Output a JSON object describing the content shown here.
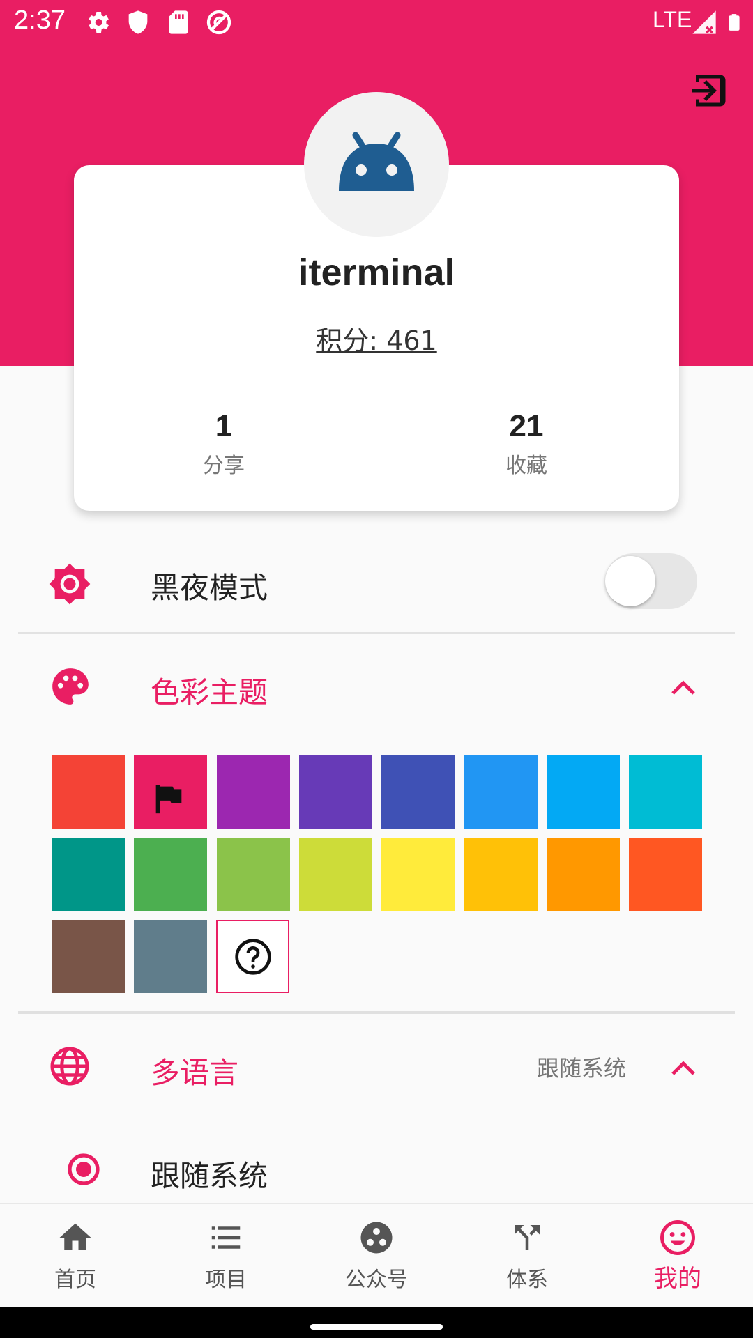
{
  "status_bar": {
    "time": "2:37",
    "network": "LTE"
  },
  "profile": {
    "username": "iterminal",
    "points": "积分: 461",
    "stats": [
      {
        "count": "1",
        "label": "分享"
      },
      {
        "count": "21",
        "label": "收藏"
      }
    ]
  },
  "settings": {
    "dark_mode": {
      "label": "黑夜模式",
      "enabled": false
    },
    "color_theme": {
      "label": "色彩主题",
      "expanded": true,
      "selected": "#e91e63",
      "colors": [
        "#f44336",
        "#e91e63",
        "#9c27b0",
        "#673ab7",
        "#3f51b5",
        "#2196f3",
        "#03a9f4",
        "#00bcd4",
        "#009688",
        "#4caf50",
        "#8bc34a",
        "#cddc39",
        "#ffeb3b",
        "#ffc107",
        "#ff9800",
        "#ff5722",
        "#795548",
        "#607d8b"
      ]
    },
    "language": {
      "label": "多语言",
      "value": "跟随系统",
      "expanded": true,
      "options": [
        {
          "label": "跟随系统",
          "selected": true
        }
      ]
    }
  },
  "bottom_nav": {
    "active_index": 4,
    "items": [
      {
        "label": "首页",
        "icon": "home-icon"
      },
      {
        "label": "项目",
        "icon": "list-icon"
      },
      {
        "label": "公众号",
        "icon": "public-account-icon"
      },
      {
        "label": "体系",
        "icon": "system-fork-icon"
      },
      {
        "label": "我的",
        "icon": "smiley-icon"
      }
    ]
  },
  "colors": {
    "accent": "#e91e63",
    "nav_inactive": "#555555",
    "text_primary": "#222222",
    "text_secondary": "#777777"
  }
}
